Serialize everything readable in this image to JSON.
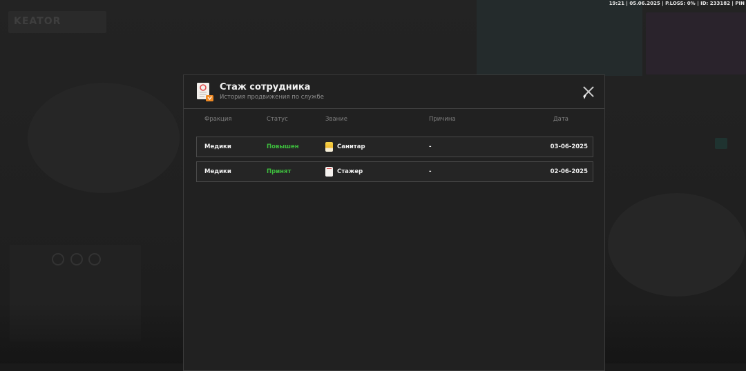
{
  "status_bar": {
    "text": "19:21 | 05.06.2025 | P.LOSS: 0% | ID: 233182 | PIN"
  },
  "modal": {
    "title": "Стаж сотрудника",
    "subtitle": "История продвижения по службе",
    "icon": "document-certificate-icon",
    "close_icon": "close-icon",
    "columns": {
      "faction": "Фракция",
      "status": "Статус",
      "rank": "Звание",
      "reason": "Причина",
      "date": "Дата"
    },
    "rows": [
      {
        "faction": "Медики",
        "status": "Повышен",
        "rank": "Санитар",
        "rank_icon": "rank-badge-yellow-icon",
        "reason": "-",
        "date": "03-06-2025"
      },
      {
        "faction": "Медики",
        "status": "Принят",
        "rank": "Стажер",
        "rank_icon": "rank-badge-white-icon",
        "reason": "-",
        "date": "02-06-2025"
      }
    ]
  },
  "colors": {
    "status_green": "#3dba3d",
    "modal_bg": "#212121",
    "border": "#4a4a4a"
  }
}
